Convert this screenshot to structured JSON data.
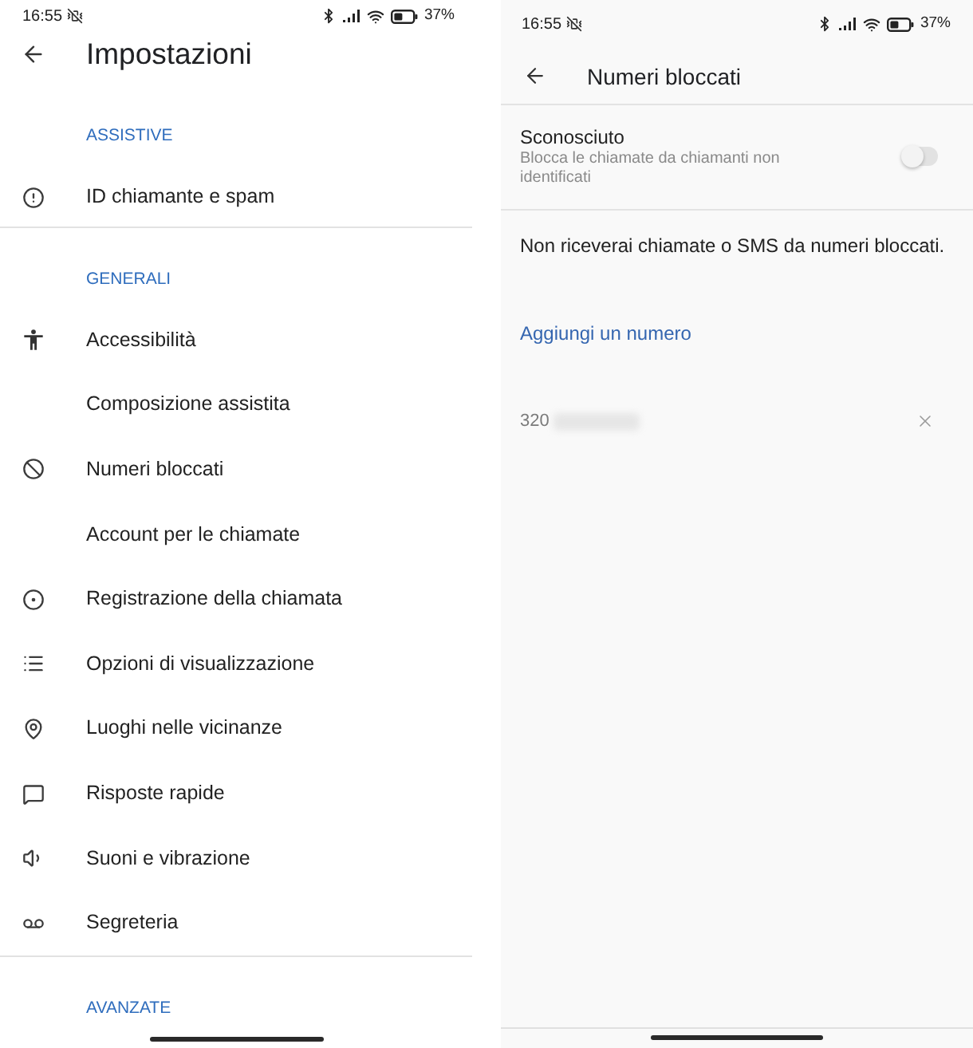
{
  "settings_screen": {
    "status_bar": {
      "time": "16:55",
      "battery": "37%"
    },
    "header": {
      "title": "Impostazioni"
    },
    "sections": [
      {
        "heading": "ASSISTIVE",
        "items": [
          {
            "label": "ID chiamante e spam"
          }
        ]
      },
      {
        "heading": "GENERALI",
        "items": [
          {
            "label": "Accessibilità"
          },
          {
            "label": "Composizione assistita"
          },
          {
            "label": "Numeri bloccati"
          },
          {
            "label": "Account per le chiamate"
          },
          {
            "label": "Registrazione della chiamata"
          },
          {
            "label": "Opzioni di visualizzazione"
          },
          {
            "label": "Luoghi nelle vicinanze"
          },
          {
            "label": "Risposte rapide"
          },
          {
            "label": "Suoni e vibrazione"
          },
          {
            "label": "Segreteria"
          }
        ]
      },
      {
        "heading": "AVANZATE"
      }
    ]
  },
  "blocked_numbers_screen": {
    "status_bar": {
      "time": "16:55",
      "battery": "37%"
    },
    "header": {
      "title": "Numeri bloccati"
    },
    "unknown_callers": {
      "title": "Sconosciuto",
      "description": "Blocca le chiamate da chiamanti non identificati",
      "on": false
    },
    "notice": "Non riceverai chiamate o SMS da numeri bloccati.",
    "add_number_link": "Aggiungi un numero",
    "blocked_numbers": [
      {
        "number": "320"
      }
    ]
  }
}
